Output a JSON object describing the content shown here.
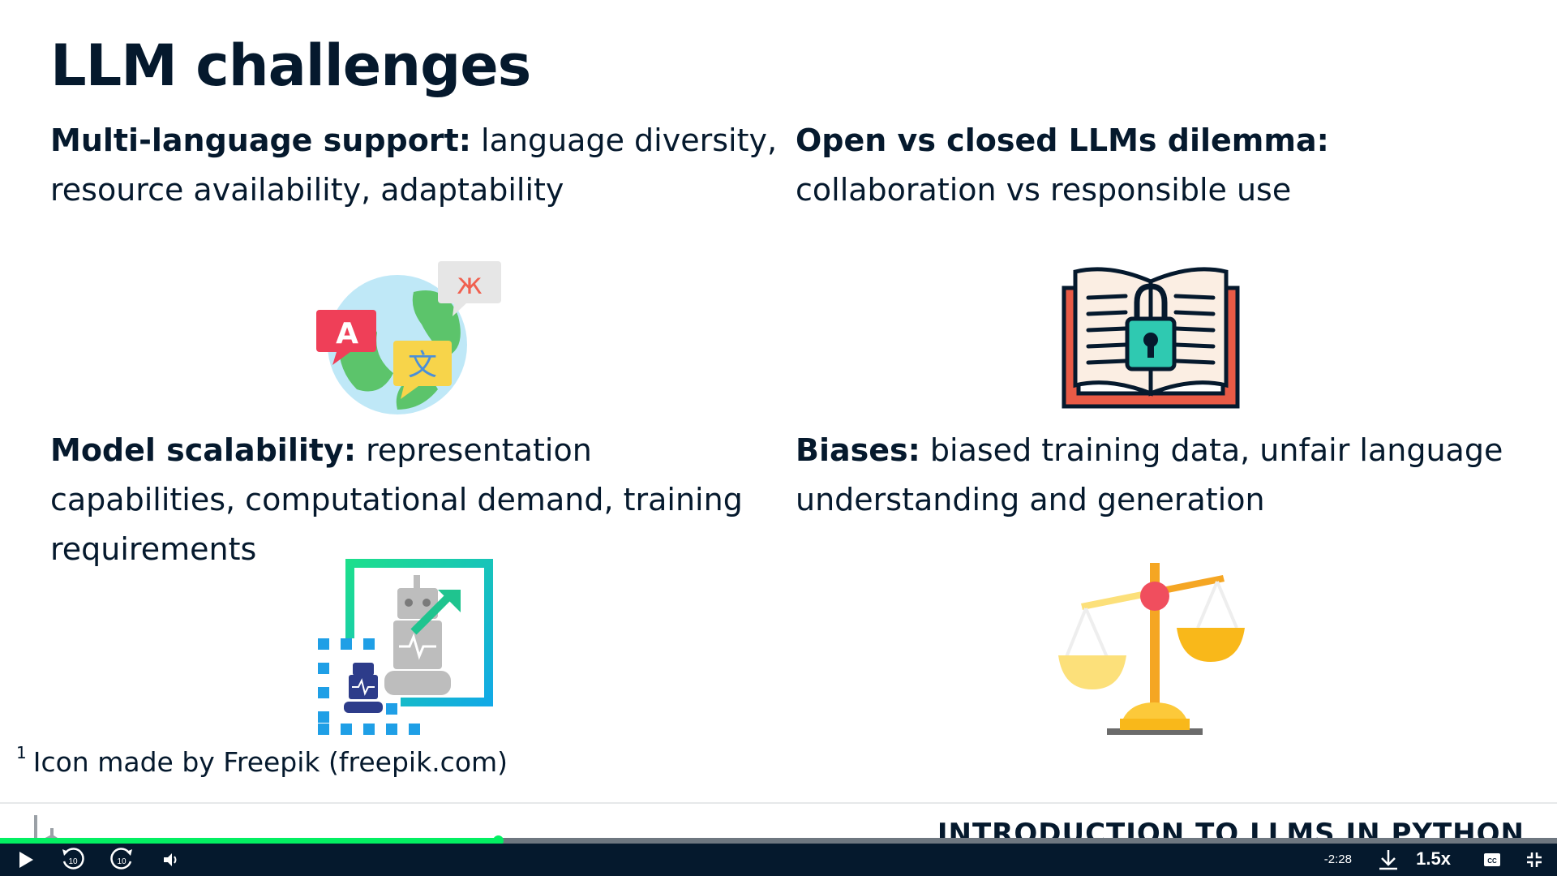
{
  "slide": {
    "title": "LLM challenges",
    "blocks": [
      {
        "heading": "Multi-language support:",
        "text": " language diversity, resource availability, adaptability"
      },
      {
        "heading": "Open vs closed LLMs dilemma:",
        "text": " collaboration vs responsible use"
      },
      {
        "heading": "Model scalability:",
        "text": " representation capabilities, computational demand, training requirements"
      },
      {
        "heading": "Biases:",
        "text": " biased training data, unfair language understanding and generation"
      }
    ],
    "footnote_marker": "1",
    "footnote": "Icon made by Freepik (freepik.com)",
    "icons": [
      "globe-translate-icon",
      "locked-book-icon",
      "robot-scaling-icon",
      "balance-scale-icon"
    ]
  },
  "footer": {
    "brand": "datacamp",
    "course_title": "INTRODUCTION TO LLMS IN PYTHON"
  },
  "player": {
    "progress_percent": 32,
    "time_remaining": "-2:28",
    "speed": "1.5x",
    "rewind_seconds": "10",
    "forward_seconds": "10"
  },
  "colors": {
    "text": "#05192d",
    "accent": "#03ef62",
    "control_bar": "#05192d"
  }
}
